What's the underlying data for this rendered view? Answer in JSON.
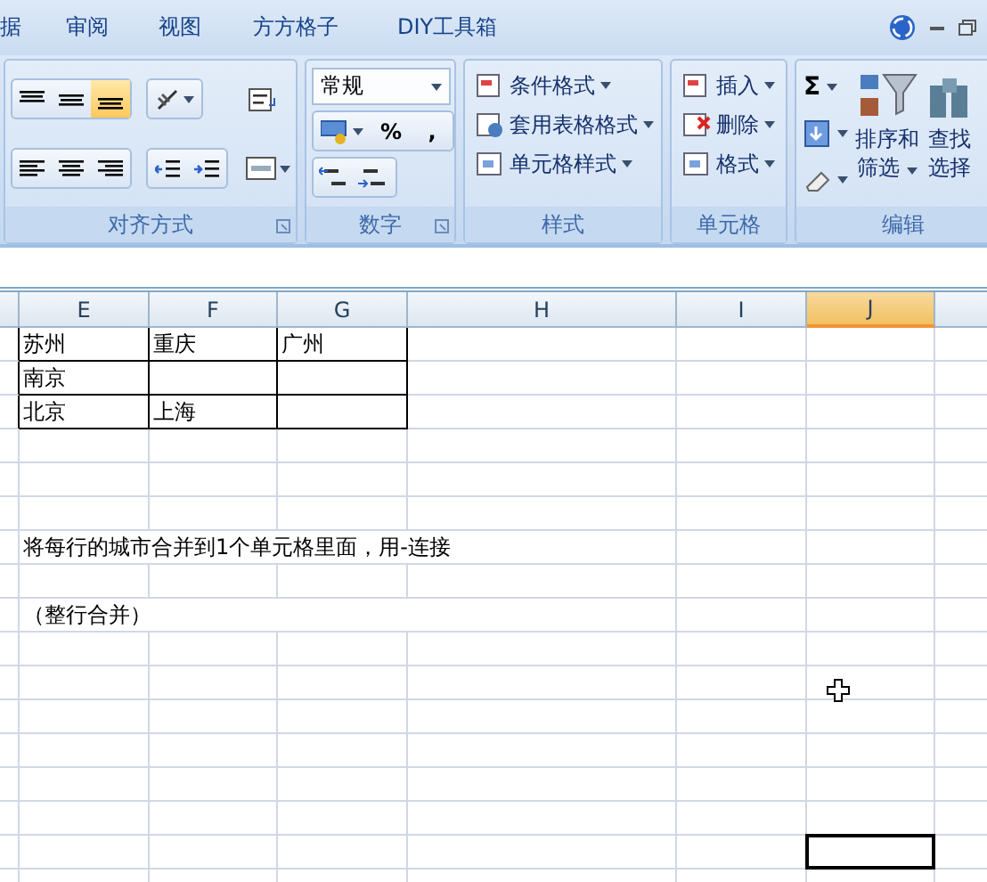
{
  "menu_tabs": [
    {
      "label": "据",
      "selected": false
    },
    {
      "label": "审阅",
      "selected": false
    },
    {
      "label": "视图",
      "selected": false
    },
    {
      "label": "方方格子",
      "selected": false
    },
    {
      "label": "DIY工具箱",
      "selected": false
    }
  ],
  "ribbon": [
    {
      "kind": "alignment",
      "label": "对齐方式",
      "vertical_align": [
        {
          "selected": false
        },
        {
          "selected": false
        },
        {
          "selected": true
        }
      ]
    },
    {
      "kind": "number",
      "label": "数字",
      "format": "常规",
      "buttons": [
        "%",
        ","
      ]
    },
    {
      "kind": "styles",
      "label": "样式",
      "items": [
        "条件格式",
        "套用表格格式",
        "单元格样式"
      ]
    },
    {
      "kind": "cells",
      "label": "单元格",
      "items": [
        "插入",
        "删除",
        "格式"
      ]
    },
    {
      "kind": "editing",
      "label": "编辑",
      "sum": "Σ",
      "sort": [
        "排序和",
        "筛选"
      ],
      "find": [
        "查找",
        "选择"
      ]
    }
  ],
  "columns": [
    {
      "label": "E",
      "selected": false
    },
    {
      "label": "F",
      "selected": false
    },
    {
      "label": "G",
      "selected": false
    },
    {
      "label": "H",
      "selected": false
    },
    {
      "label": "I",
      "selected": false
    },
    {
      "label": "J",
      "selected": true
    }
  ],
  "rows": [
    {
      "selected": false,
      "bordered": true,
      "cells": [
        "苏州",
        "重庆",
        "广州"
      ]
    },
    {
      "selected": false,
      "bordered": true,
      "cells": [
        "南京",
        null,
        null
      ]
    },
    {
      "selected": false,
      "bordered": true,
      "cells": [
        "北京",
        "上海",
        null
      ]
    },
    {
      "selected": false
    },
    {
      "selected": false
    },
    {
      "selected": false
    },
    {
      "selected": false,
      "note": "将每行的城市合并到1个单元格里面，用-连接"
    },
    {
      "selected": false
    },
    {
      "selected": false,
      "note": "（整行合并）"
    },
    {
      "selected": false
    },
    {
      "selected": false
    },
    {
      "selected": false
    },
    {
      "selected": false
    },
    {
      "selected": false
    },
    {
      "selected": false
    },
    {
      "selected": true
    },
    {
      "selected": false
    }
  ]
}
